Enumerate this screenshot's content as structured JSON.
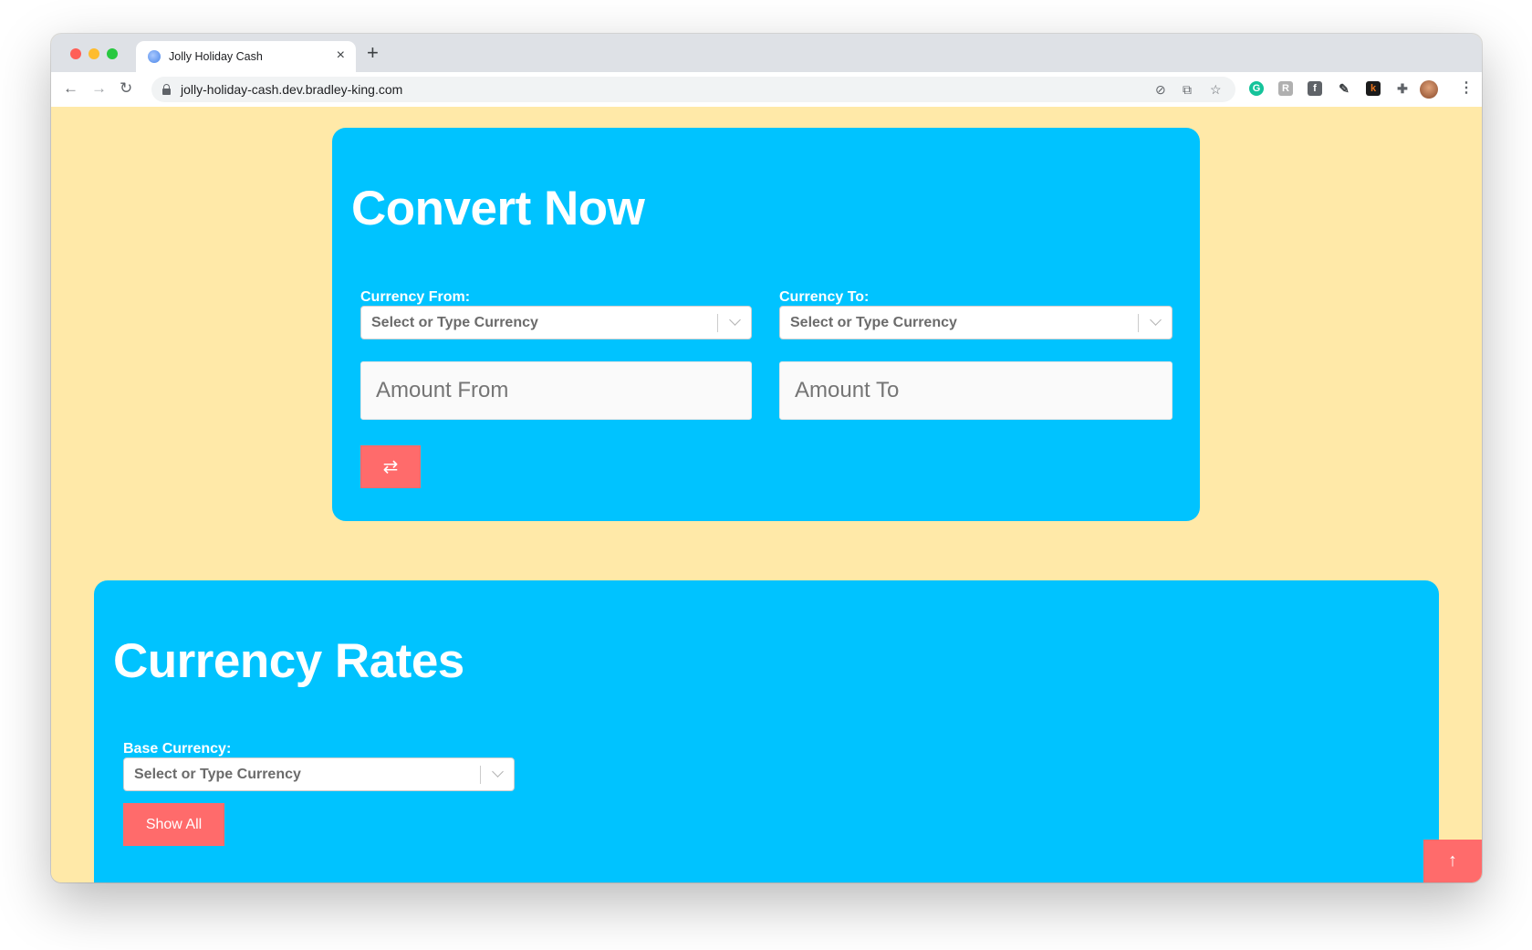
{
  "browser": {
    "tab_title": "Jolly Holiday Cash",
    "tab_close": "×",
    "new_tab": "+",
    "url": "jolly-holiday-cash.dev.bradley-king.com",
    "extensions": [
      {
        "name": "grammarly-icon",
        "color": "#15c39a",
        "glyph": "G"
      },
      {
        "name": "extension-r-icon",
        "color": "#b0b0b0",
        "glyph": "R"
      },
      {
        "name": "facebook-icon",
        "color": "#5f6368",
        "glyph": "f"
      },
      {
        "name": "extension-k-icon",
        "color": "#e8731c",
        "glyph": "k"
      }
    ]
  },
  "converter": {
    "title": "Convert Now",
    "from_label": "Currency From:",
    "to_label": "Currency To:",
    "from_select": "Select or Type Currency",
    "to_select": "Select or Type Currency",
    "amount_from_placeholder": "Amount From",
    "amount_to_placeholder": "Amount To",
    "swap_glyph": "⇄"
  },
  "rates": {
    "title": "Currency Rates",
    "base_label": "Base Currency:",
    "base_select": "Select or Type Currency",
    "show_all_label": "Show All"
  },
  "scroll_top_glyph": "↑",
  "colors": {
    "page_background": "#ffe9a8",
    "card": "#00c3ff",
    "button": "#ff6b6b"
  }
}
